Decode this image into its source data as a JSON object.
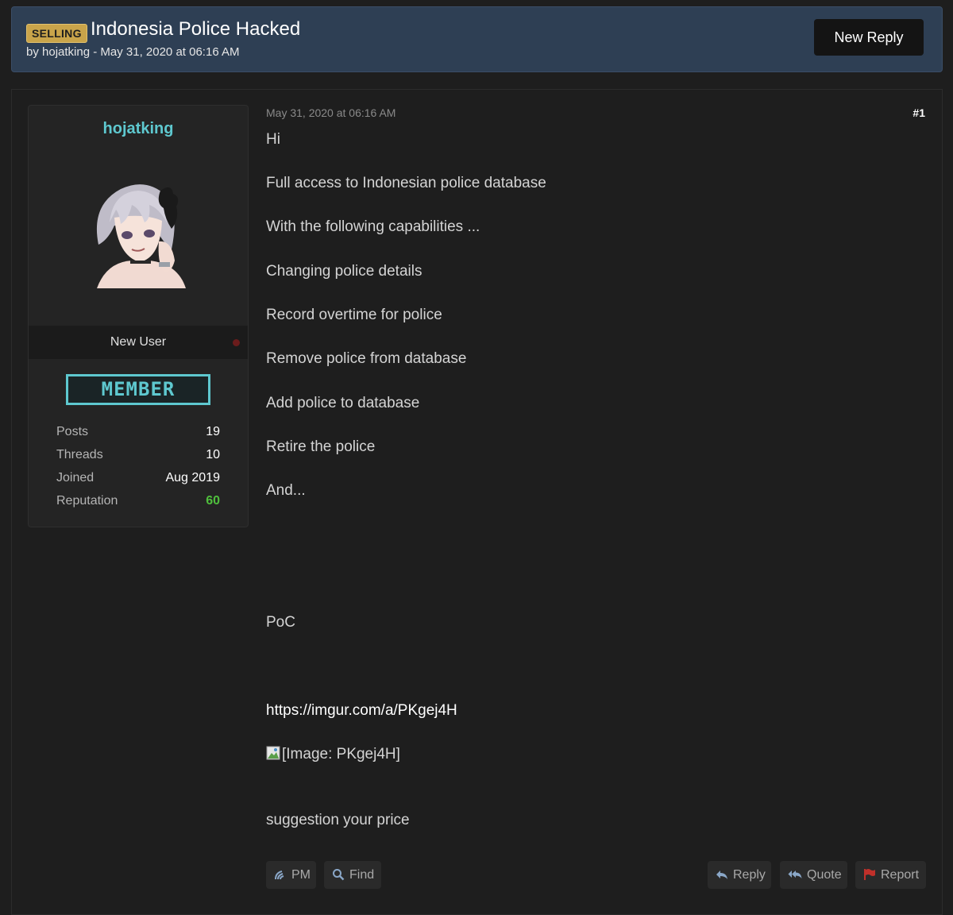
{
  "thread": {
    "prefix": "SELLING",
    "title": "Indonesia Police Hacked",
    "byline": "by hojatking - May 31, 2020 at 06:16 AM",
    "new_reply_label": "New Reply"
  },
  "author": {
    "username": "hojatking",
    "user_title": "New User",
    "rank_badge": "MEMBER",
    "stats": [
      {
        "label": "Posts",
        "value": "19"
      },
      {
        "label": "Threads",
        "value": "10"
      },
      {
        "label": "Joined",
        "value": "Aug 2019"
      },
      {
        "label": "Reputation",
        "value": "60"
      }
    ],
    "status_color": "#6b1c1c"
  },
  "post": {
    "date": "May 31, 2020 at 06:16 AM",
    "number": "#1",
    "lines": [
      "Hi",
      "Full access to Indonesian police database",
      "With the following capabilities ...",
      "Changing police details",
      "Record overtime for police",
      "Remove police from database",
      "Add police to database",
      "Retire the police",
      "And...",
      "PoC"
    ],
    "link": "https://imgur.com/a/PKgej4H",
    "image_alt": "[Image: PKgej4H]",
    "closing": "suggestion your price"
  },
  "actions": {
    "pm": "PM",
    "find": "Find",
    "reply": "Reply",
    "quote": "Quote",
    "report": "Report"
  },
  "icons": [
    "broken-image-icon",
    "pm-icon",
    "search-icon",
    "reply-icon",
    "quote-icon",
    "flag-icon"
  ],
  "colors": {
    "accent": "#5ec8cf",
    "header_bg": "#2e3f54",
    "prefix_badge": "#c9a44a",
    "reputation": "#4fbf3c",
    "report_flag": "#c0302a"
  }
}
